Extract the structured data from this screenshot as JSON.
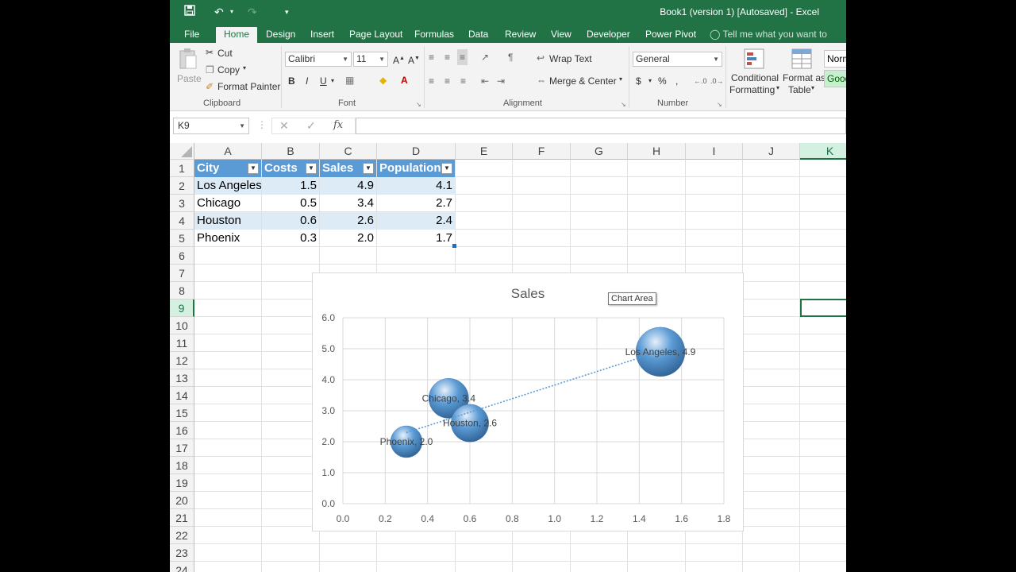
{
  "window": {
    "title": "Book1 (version 1) [Autosaved] - Excel"
  },
  "tabs": [
    "File",
    "Home",
    "Design",
    "Insert",
    "Page Layout",
    "Formulas",
    "Data",
    "Review",
    "View",
    "Developer",
    "Power Pivot"
  ],
  "active_tab": "Home",
  "tell_me": "Tell me what you want to do...",
  "ribbon": {
    "clipboard": {
      "paste": "Paste",
      "cut": "Cut",
      "copy": "Copy",
      "format_painter": "Format Painter",
      "label": "Clipboard"
    },
    "font": {
      "name": "Calibri",
      "size": "11",
      "bold": "B",
      "italic": "I",
      "underline": "U",
      "label": "Font"
    },
    "alignment": {
      "wrap_text": "Wrap Text",
      "merge_center": "Merge & Center",
      "label": "Alignment"
    },
    "number": {
      "format": "General",
      "currency": "$",
      "percent": "%",
      "comma": ",",
      "label": "Number"
    },
    "styles": {
      "conditional": "Conditional",
      "formatting": "Formatting",
      "format_as": "Format as",
      "table": "Table",
      "normal": "Normal",
      "good": "Good"
    }
  },
  "formula_bar": {
    "name_box": "K9",
    "value": ""
  },
  "columns": [
    "A",
    "B",
    "C",
    "D",
    "E",
    "F",
    "G",
    "H",
    "I",
    "J",
    "K"
  ],
  "selected_column": "K",
  "rows": [
    "1",
    "2",
    "3",
    "4",
    "5",
    "6",
    "7",
    "8",
    "9",
    "10",
    "11",
    "12",
    "13",
    "14",
    "15",
    "16",
    "17",
    "18",
    "19",
    "20",
    "21",
    "22",
    "23",
    "24"
  ],
  "selected_row": "9",
  "table": {
    "headers": [
      "City",
      "Costs",
      "Sales",
      "Population"
    ],
    "rows": [
      [
        "Los Angeles",
        "1.5",
        "4.9",
        "4.1"
      ],
      [
        "Chicago",
        "0.5",
        "3.4",
        "2.7"
      ],
      [
        "Houston",
        "0.6",
        "2.6",
        "2.4"
      ],
      [
        "Phoenix",
        "0.3",
        "2.0",
        "1.7"
      ]
    ]
  },
  "chart_tooltip": "Chart Area",
  "chart_data": {
    "type": "scatter",
    "title": "Sales",
    "xlim": [
      0,
      1.8
    ],
    "ylim": [
      0,
      6
    ],
    "x_ticks": [
      "0.0",
      "0.2",
      "0.4",
      "0.6",
      "0.8",
      "1.0",
      "1.2",
      "1.4",
      "1.6",
      "1.8"
    ],
    "y_ticks": [
      "0.0",
      "1.0",
      "2.0",
      "3.0",
      "4.0",
      "5.0",
      "6.0"
    ],
    "grid": true,
    "bubble": true,
    "points": [
      {
        "label": "Los Angeles, 4.9",
        "x": 1.5,
        "y": 4.9,
        "size": 4.1
      },
      {
        "label": "Chicago, 3.4",
        "x": 0.5,
        "y": 3.4,
        "size": 2.7
      },
      {
        "label": "Houston, 2.6",
        "x": 0.6,
        "y": 2.6,
        "size": 2.4
      },
      {
        "label": "Phoenix, 2.0",
        "x": 0.3,
        "y": 2.0,
        "size": 1.7
      }
    ],
    "trendline": "linear, dotted",
    "colors": {
      "bubble": "#5b9bd5",
      "trendline": "#5b9bd5",
      "grid": "#d9d9d9"
    }
  }
}
